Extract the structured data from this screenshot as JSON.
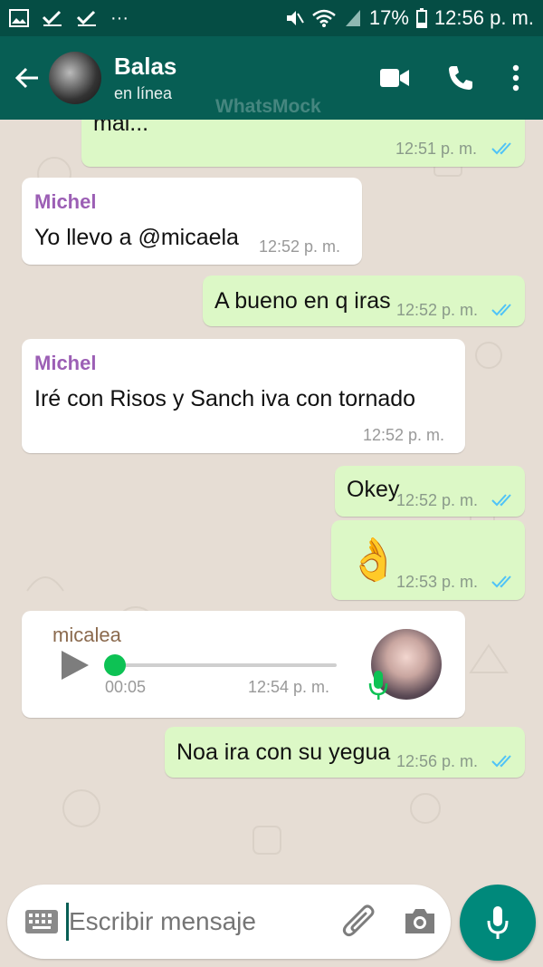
{
  "status_bar": {
    "battery": "17%",
    "time": "12:56 p. m."
  },
  "header": {
    "contact_name": "Balas",
    "status": "en línea",
    "watermark": "WhatsMock"
  },
  "messages": [
    {
      "direction": "out",
      "text": "mal...",
      "time": "12:51 p. m."
    },
    {
      "direction": "in",
      "sender": "Michel",
      "text": "Yo llevo a @micaela",
      "time": "12:52 p. m."
    },
    {
      "direction": "out",
      "text": "A bueno en q iras",
      "time": "12:52 p. m."
    },
    {
      "direction": "in",
      "sender": "Michel",
      "text": "Iré con  Risos y  Sanch iva con tornado",
      "time": "12:52 p. m."
    },
    {
      "direction": "out",
      "text": "Okey",
      "time": "12:52 p. m."
    },
    {
      "direction": "out",
      "text": "👌",
      "time": "12:53 p. m."
    },
    {
      "direction": "in",
      "sender": "micalea",
      "type": "voice",
      "duration": "00:05",
      "time": "12:54 p. m.",
      "progress": 0
    },
    {
      "direction": "out",
      "text": "Noa ira con su yegua",
      "time": "12:56 p. m."
    }
  ],
  "input": {
    "placeholder": "Escribir mensaje"
  },
  "colors": {
    "header": "#075e54",
    "status_bar": "#054d44",
    "outgoing_bubble": "#dcf8c6",
    "incoming_bubble": "#ffffff",
    "sender_name": "#9c5fb5",
    "voice_sender": "#8b6a4e",
    "read_ticks": "#4fc3f7",
    "fab": "#00897b"
  },
  "icons": [
    "gallery-icon",
    "check-icon",
    "check-icon",
    "more-dots-icon",
    "mute-icon",
    "wifi-icon",
    "signal-icon",
    "battery-icon",
    "back-arrow-icon",
    "video-call-icon",
    "phone-icon",
    "menu-dots-icon",
    "play-icon",
    "mic-icon",
    "keyboard-icon",
    "attach-icon",
    "camera-icon"
  ]
}
